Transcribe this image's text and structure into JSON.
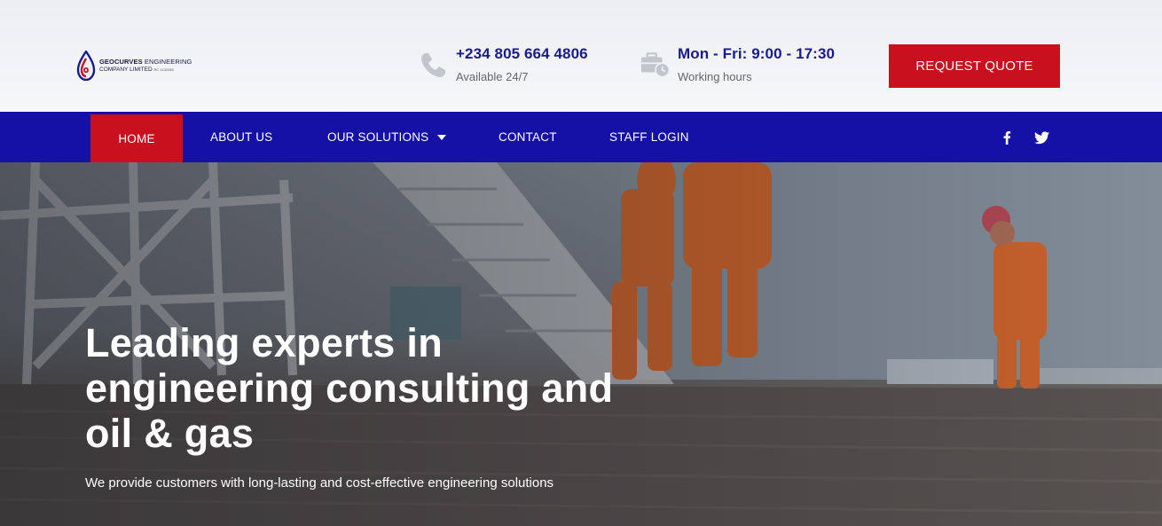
{
  "header": {
    "logo": {
      "line1_bold": "GEOCURVES",
      "line1_rest": " ENGINEERING",
      "line2": "COMPANY LIMITED",
      "line2_small": "RC 1132285"
    },
    "phone": {
      "title": "+234 805 664 4806",
      "sub": "Available 24/7",
      "icon": "phone-icon"
    },
    "hours": {
      "title": "Mon - Fri: 9:00 - 17:30",
      "sub": "Working hours",
      "icon": "briefcase-clock-icon"
    },
    "quote_button": "REQUEST QUOTE"
  },
  "nav": {
    "items": [
      {
        "label": "HOME",
        "active": true
      },
      {
        "label": "ABOUT US"
      },
      {
        "label": "OUR SOLUTIONS",
        "dropdown": true
      },
      {
        "label": "CONTACT"
      },
      {
        "label": "STAFF LOGIN"
      }
    ],
    "social": [
      "facebook-icon",
      "twitter-icon"
    ]
  },
  "hero": {
    "title": "Leading experts in engineering consulting and oil & gas",
    "subtitle": "We provide customers with long-lasting and cost-effective engineering solutions"
  },
  "colors": {
    "primary_blue": "#1510a6",
    "accent_red": "#c8101e",
    "heading_blue": "#1a1a8c"
  }
}
